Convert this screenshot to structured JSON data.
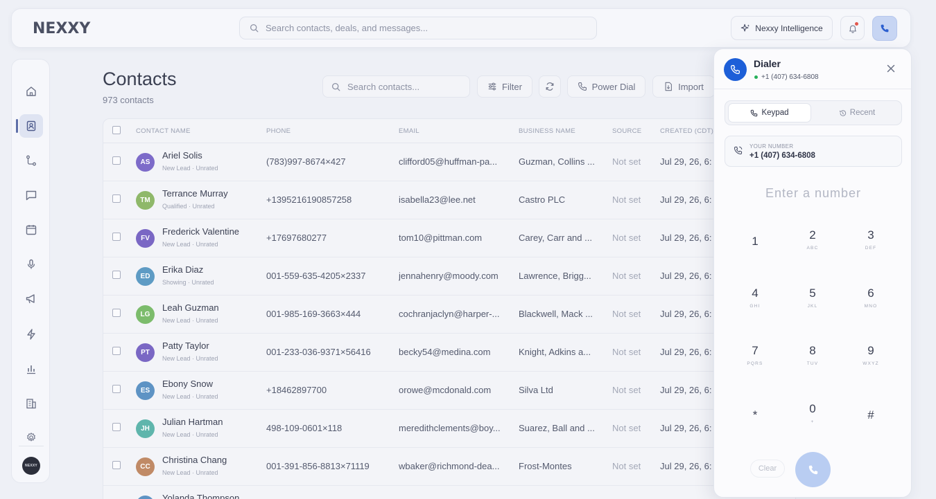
{
  "app": {
    "logo": "NEXXY"
  },
  "header": {
    "search_placeholder": "Search contacts, deals, and messages...",
    "intelligence_label": "Nexxy Intelligence"
  },
  "sidebar": {
    "items": [
      "home-icon",
      "contacts-icon",
      "pipeline-icon",
      "messages-icon",
      "calendar-icon",
      "microphone-icon",
      "campaigns-icon",
      "automations-icon",
      "reports-icon",
      "company-icon",
      "settings-icon"
    ],
    "active": "contacts-icon",
    "user_avatar_text": "NEXXY"
  },
  "page": {
    "title": "Contacts",
    "count": "973 contacts"
  },
  "toolbar": {
    "search_placeholder": "Search contacts...",
    "filter_label": "Filter",
    "power_dial_label": "Power Dial",
    "import_label": "Import"
  },
  "table": {
    "columns": [
      "CONTACT NAME",
      "PHONE",
      "EMAIL",
      "BUSINESS NAME",
      "SOURCE",
      "CREATED (CDT)"
    ],
    "rows": [
      {
        "initials": "AS",
        "color": "#7d6bc9",
        "name": "Ariel Solis",
        "sub": "New Lead · Unrated",
        "phone": "(783)997-8674×427",
        "email": "clifford05@huffman-pa...",
        "business": "Guzman, Collins ...",
        "source": "Not set",
        "created": "Jul 29, 26, 6:"
      },
      {
        "initials": "TM",
        "color": "#8fb86a",
        "name": "Terrance Murray",
        "sub": "Qualified · Unrated",
        "phone": "+1395216190857258",
        "email": "isabella23@lee.net",
        "business": "Castro PLC",
        "source": "Not set",
        "created": "Jul 29, 26, 6:"
      },
      {
        "initials": "FV",
        "color": "#7a67c4",
        "name": "Frederick Valentine",
        "sub": "New Lead · Unrated",
        "phone": "+17697680277",
        "email": "tom10@pittman.com",
        "business": "Carey, Carr and ...",
        "source": "Not set",
        "created": "Jul 29, 26, 6:"
      },
      {
        "initials": "ED",
        "color": "#5e9bc4",
        "name": "Erika Diaz",
        "sub": "Showing · Unrated",
        "phone": "001-559-635-4205×2337",
        "email": "jennahenry@moody.com",
        "business": "Lawrence, Brigg...",
        "source": "Not set",
        "created": "Jul 29, 26, 6:"
      },
      {
        "initials": "LG",
        "color": "#7cbc6c",
        "name": "Leah Guzman",
        "sub": "New Lead · Unrated",
        "phone": "001-985-169-3663×444",
        "email": "cochranjaclyn@harper-...",
        "business": "Blackwell, Mack ...",
        "source": "Not set",
        "created": "Jul 29, 26, 6:"
      },
      {
        "initials": "PT",
        "color": "#7a67c4",
        "name": "Patty Taylor",
        "sub": "New Lead · Unrated",
        "phone": "001-233-036-9371×56416",
        "email": "becky54@medina.com",
        "business": "Knight, Adkins a...",
        "source": "Not set",
        "created": "Jul 29, 26, 6:"
      },
      {
        "initials": "ES",
        "color": "#5e93c4",
        "name": "Ebony Snow",
        "sub": "New Lead · Unrated",
        "phone": "+18462897700",
        "email": "orowe@mcdonald.com",
        "business": "Silva Ltd",
        "source": "Not set",
        "created": "Jul 29, 26, 6:"
      },
      {
        "initials": "JH",
        "color": "#5fb5ac",
        "name": "Julian Hartman",
        "sub": "New Lead · Unrated",
        "phone": "498-109-0601×118",
        "email": "meredithclements@boy...",
        "business": "Suarez, Ball and ...",
        "source": "Not set",
        "created": "Jul 29, 26, 6:"
      },
      {
        "initials": "CC",
        "color": "#c08a66",
        "name": "Christina Chang",
        "sub": "New Lead · Unrated",
        "phone": "001-391-856-8813×71119",
        "email": "wbaker@richmond-dea...",
        "business": "Frost-Montes",
        "source": "Not set",
        "created": "Jul 29, 26, 6:"
      },
      {
        "initials": "YT",
        "color": "#5e93c4",
        "name": "Yolanda Thompson",
        "sub": "",
        "phone": "",
        "email": "",
        "business": "",
        "source": "",
        "created": ""
      }
    ]
  },
  "dialer": {
    "title": "Dialer",
    "number": "+1 (407) 634-6808",
    "tab_keypad": "Keypad",
    "tab_recent": "Recent",
    "your_number_label": "YOUR NUMBER",
    "your_number": "+1 (407) 634-6808",
    "input_placeholder": "Enter a number",
    "keys": [
      {
        "d": "1",
        "l": ""
      },
      {
        "d": "2",
        "l": "ABC"
      },
      {
        "d": "3",
        "l": "DEF"
      },
      {
        "d": "4",
        "l": "GHI"
      },
      {
        "d": "5",
        "l": "JKL"
      },
      {
        "d": "6",
        "l": "MNO"
      },
      {
        "d": "7",
        "l": "PQRS"
      },
      {
        "d": "8",
        "l": "TUV"
      },
      {
        "d": "9",
        "l": "WXYZ"
      },
      {
        "d": "*",
        "l": ""
      },
      {
        "d": "0",
        "l": "+"
      },
      {
        "d": "#",
        "l": ""
      }
    ],
    "clear_label": "Clear"
  }
}
